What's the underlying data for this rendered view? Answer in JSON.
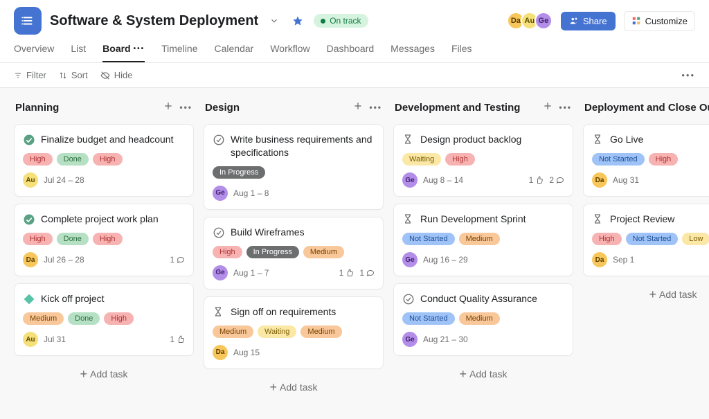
{
  "header": {
    "title": "Software & System Deployment",
    "status": "On track",
    "share": "Share",
    "customize": "Customize",
    "people": [
      {
        "id": "da",
        "label": "Da"
      },
      {
        "id": "au",
        "label": "Au"
      },
      {
        "id": "ge",
        "label": "Ge"
      }
    ]
  },
  "tabs": [
    "Overview",
    "List",
    "Board",
    "Timeline",
    "Calendar",
    "Workflow",
    "Dashboard",
    "Messages",
    "Files"
  ],
  "active_tab": "Board",
  "toolbar": {
    "filter": "Filter",
    "sort": "Sort",
    "hide": "Hide"
  },
  "add_task_label": "Add task",
  "columns": [
    {
      "name": "Planning",
      "cards": [
        {
          "status_icon": "done",
          "title": "Finalize budget and headcount",
          "tags": [
            {
              "t": "High",
              "c": "red"
            },
            {
              "t": "Done",
              "c": "green"
            },
            {
              "t": "High",
              "c": "red"
            }
          ],
          "assignee": {
            "id": "au",
            "label": "Au"
          },
          "date": "Jul 24 – 28",
          "likes": null,
          "comments": null
        },
        {
          "status_icon": "done",
          "title": "Complete project work plan",
          "tags": [
            {
              "t": "High",
              "c": "red"
            },
            {
              "t": "Done",
              "c": "green"
            },
            {
              "t": "High",
              "c": "red"
            }
          ],
          "assignee": {
            "id": "da",
            "label": "Da"
          },
          "date": "Jul 26 – 28",
          "likes": null,
          "comments": "1"
        },
        {
          "status_icon": "diamond",
          "title": "Kick off project",
          "tags": [
            {
              "t": "Medium",
              "c": "orange"
            },
            {
              "t": "Done",
              "c": "green"
            },
            {
              "t": "High",
              "c": "red"
            }
          ],
          "assignee": {
            "id": "au",
            "label": "Au"
          },
          "date": "Jul 31",
          "likes": "1",
          "comments": null
        }
      ]
    },
    {
      "name": "Design",
      "cards": [
        {
          "status_icon": "open",
          "title": "Write business requirements and specifications",
          "tags": [
            {
              "t": "In Progress",
              "c": "gray"
            }
          ],
          "assignee": {
            "id": "ge",
            "label": "Ge"
          },
          "date": "Aug 1 – 8",
          "likes": null,
          "comments": null
        },
        {
          "status_icon": "open",
          "title": "Build Wireframes",
          "tags": [
            {
              "t": "High",
              "c": "red"
            },
            {
              "t": "In Progress",
              "c": "gray"
            },
            {
              "t": "Medium",
              "c": "orange"
            }
          ],
          "assignee": {
            "id": "ge",
            "label": "Ge"
          },
          "date": "Aug 1 – 7",
          "likes": "1",
          "comments": "1"
        },
        {
          "status_icon": "hourglass",
          "title": "Sign off on requirements",
          "tags": [
            {
              "t": "Medium",
              "c": "orange"
            },
            {
              "t": "Waiting",
              "c": "yellow"
            },
            {
              "t": "Medium",
              "c": "orange"
            }
          ],
          "assignee": {
            "id": "da",
            "label": "Da"
          },
          "date": "Aug 15",
          "likes": null,
          "comments": null
        }
      ]
    },
    {
      "name": "Development and Testing",
      "cards": [
        {
          "status_icon": "hourglass",
          "title": "Design product backlog",
          "tags": [
            {
              "t": "Waiting",
              "c": "yellow"
            },
            {
              "t": "High",
              "c": "red"
            }
          ],
          "assignee": {
            "id": "ge",
            "label": "Ge"
          },
          "date": "Aug 8 – 14",
          "likes": "1",
          "comments": "2"
        },
        {
          "status_icon": "hourglass",
          "title": "Run Development Sprint",
          "tags": [
            {
              "t": "Not Started",
              "c": "blue"
            },
            {
              "t": "Medium",
              "c": "orange"
            }
          ],
          "assignee": {
            "id": "ge",
            "label": "Ge"
          },
          "date": "Aug 16 – 29",
          "likes": null,
          "comments": null
        },
        {
          "status_icon": "open",
          "title": "Conduct Quality Assurance",
          "tags": [
            {
              "t": "Not Started",
              "c": "blue"
            },
            {
              "t": "Medium",
              "c": "orange"
            }
          ],
          "assignee": {
            "id": "ge",
            "label": "Ge"
          },
          "date": "Aug 21 – 30",
          "likes": null,
          "comments": null
        }
      ]
    },
    {
      "name": "Deployment and Close Out",
      "cards": [
        {
          "status_icon": "hourglass",
          "title": "Go Live",
          "tags": [
            {
              "t": "Not Started",
              "c": "blue"
            },
            {
              "t": "High",
              "c": "red"
            }
          ],
          "assignee": {
            "id": "da",
            "label": "Da"
          },
          "date": "Aug 31",
          "likes": null,
          "comments": null
        },
        {
          "status_icon": "hourglass",
          "title": "Project Review",
          "tags": [
            {
              "t": "High",
              "c": "red"
            },
            {
              "t": "Not Started",
              "c": "blue"
            },
            {
              "t": "Low",
              "c": "yellow"
            }
          ],
          "assignee": {
            "id": "da",
            "label": "Da"
          },
          "date": "Sep 1",
          "likes": null,
          "comments": null
        }
      ]
    }
  ]
}
